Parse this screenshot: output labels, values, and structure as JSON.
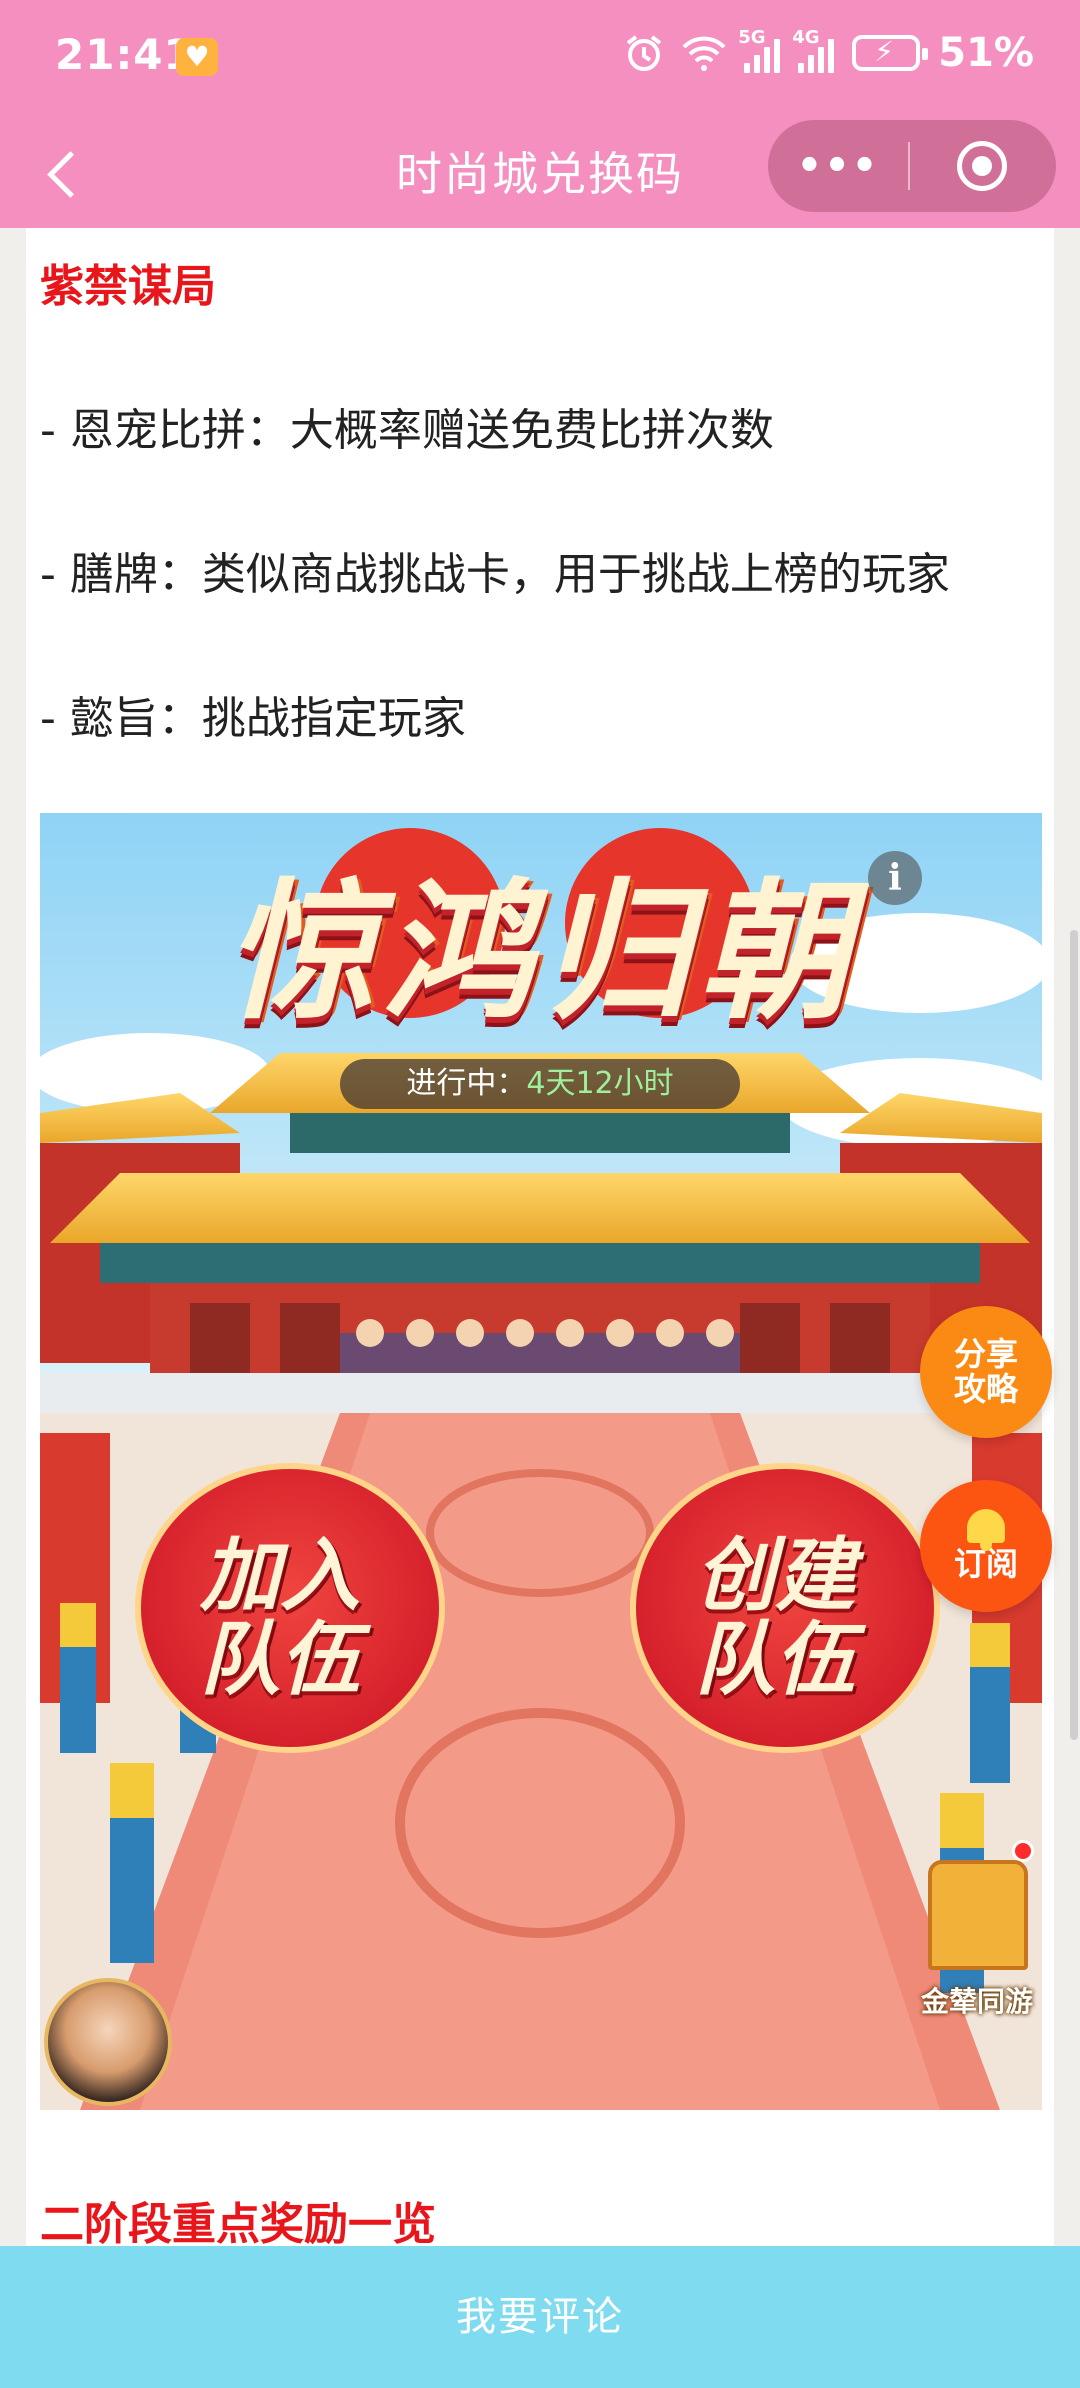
{
  "status_bar": {
    "time": "21:41",
    "network_5g": "5G",
    "network_4g": "4G",
    "battery": "51%"
  },
  "nav": {
    "title": "时尚城兑换码",
    "more": "•••"
  },
  "article": {
    "section1_heading": "紫禁谋局",
    "lines": [
      "- 恩宠比拼：大概率赠送免费比拼次数",
      "- 膳牌：类似商战挑战卡，用于挑战上榜的玩家",
      "- 懿旨：挑战指定玩家"
    ],
    "section2_heading": "二阶段重点奖励一览"
  },
  "banner": {
    "title": "惊鸿归朝",
    "status_label": "进行中：",
    "status_time": "4天12小时",
    "join_team": "加入队伍",
    "create_team": "创建队伍",
    "tour_label": "金辇同游"
  },
  "floating": {
    "share_line1": "分享",
    "share_line2": "攻略",
    "subscribe": "订阅"
  },
  "comment_bar": {
    "label": "我要评论"
  },
  "colors": {
    "header_pink": "#f58fc0",
    "heading_red": "#e8161a",
    "comment_blue": "#7fdbef",
    "share_orange": "#fb8a14",
    "subscribe_orange": "#fc5512"
  }
}
